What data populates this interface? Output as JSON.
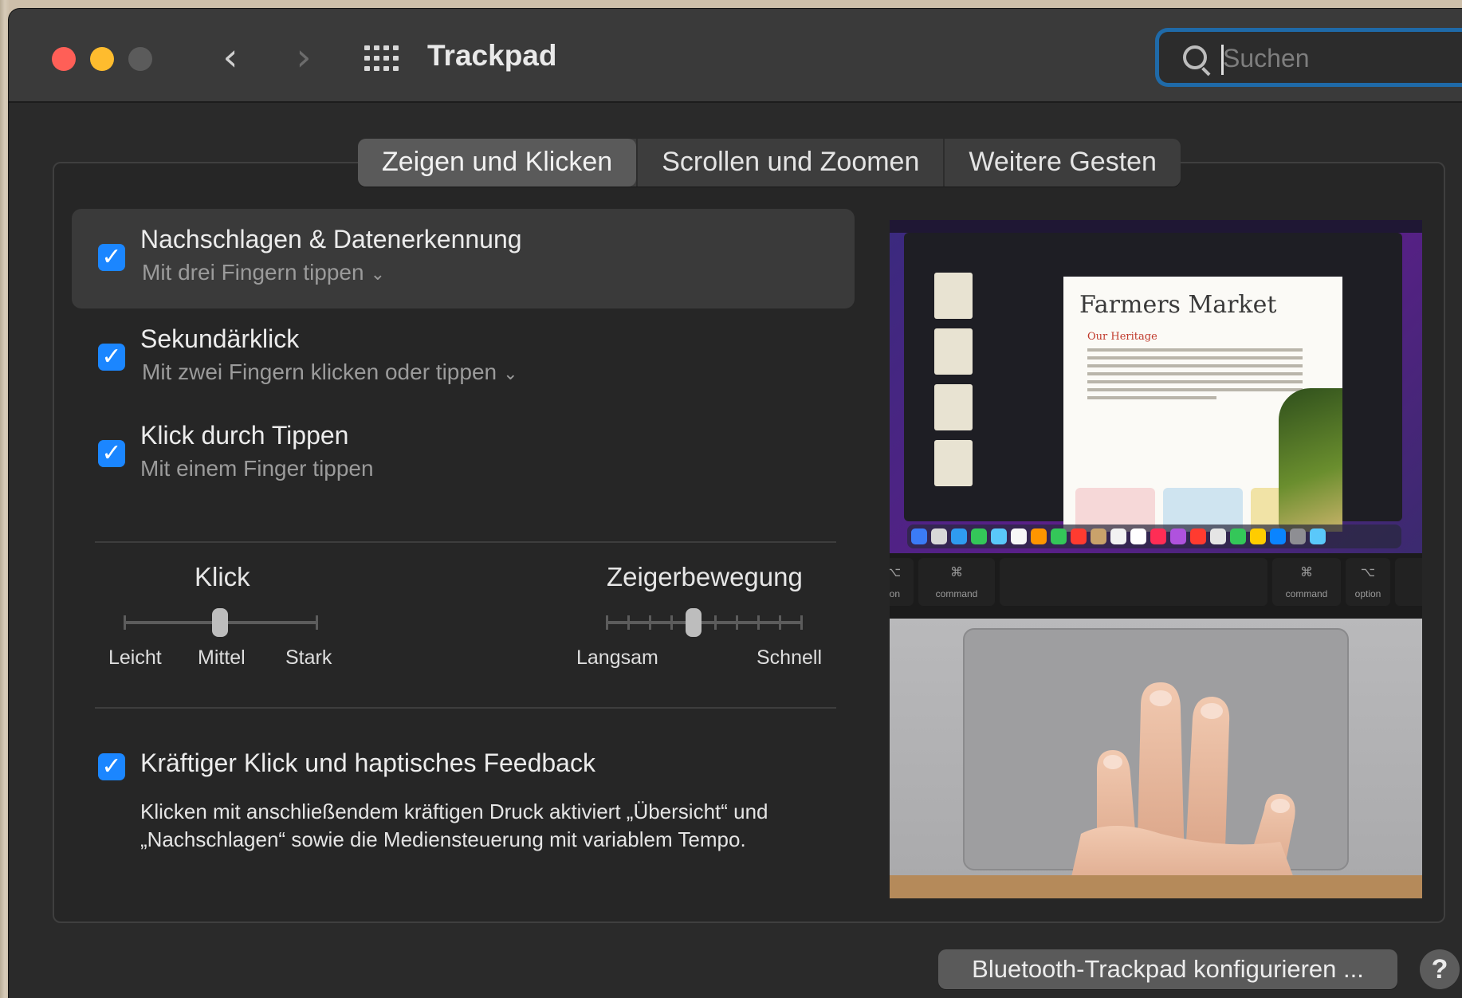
{
  "window": {
    "title": "Trackpad",
    "search_placeholder": "Suchen"
  },
  "tabs": [
    {
      "label": "Zeigen und Klicken",
      "active": true
    },
    {
      "label": "Scrollen und Zoomen",
      "active": false
    },
    {
      "label": "Weitere Gesten",
      "active": false
    }
  ],
  "options": [
    {
      "title": "Nachschlagen & Datenerkennung",
      "subtitle": "Mit drei Fingern tippen",
      "checked": true,
      "has_menu": true
    },
    {
      "title": "Sekundärklick",
      "subtitle": "Mit zwei Fingern klicken oder tippen",
      "checked": true,
      "has_menu": true
    },
    {
      "title": "Klick durch Tippen",
      "subtitle": "Mit einem Finger tippen",
      "checked": true,
      "has_menu": false
    }
  ],
  "sliders": {
    "click": {
      "label": "Klick",
      "scale": [
        "Leicht",
        "Mittel",
        "Stark"
      ],
      "value_index": 1
    },
    "pointer": {
      "label": "Zeigerbewegung",
      "min_label": "Langsam",
      "max_label": "Schnell",
      "tick_count": 10,
      "value_fraction": 0.45
    }
  },
  "force_click": {
    "title": "Kräftiger Klick und haptisches Feedback",
    "description": "Klicken mit anschließendem kräftigen Druck aktiviert „Übersicht“ und „Nachschlagen“ sowie die Mediensteuerung mit variablem Tempo.",
    "checked": true
  },
  "preview": {
    "doc_title": "Farmers Market",
    "doc_subtitle": "Our Heritage",
    "keys": [
      {
        "symbol": "⌥",
        "label": "ion"
      },
      {
        "symbol": "⌘",
        "label": "command"
      },
      {
        "symbol": "⌘",
        "label": "command"
      },
      {
        "symbol": "⌥",
        "label": "option"
      }
    ]
  },
  "buttons": {
    "bluetooth": "Bluetooth-Trackpad konfigurieren ...",
    "help": "?"
  },
  "colors": {
    "accent": "#1b86ff",
    "search_focus": "#1f6aa8",
    "close": "#ff5f57",
    "minimize": "#febc2e",
    "zoom_disabled": "#5b5b5b"
  },
  "icons": {
    "back": "chevron-left-icon",
    "forward": "chevron-right-icon",
    "grid": "grid-icon",
    "search": "search-icon",
    "checkbox": "checkmark-icon"
  }
}
